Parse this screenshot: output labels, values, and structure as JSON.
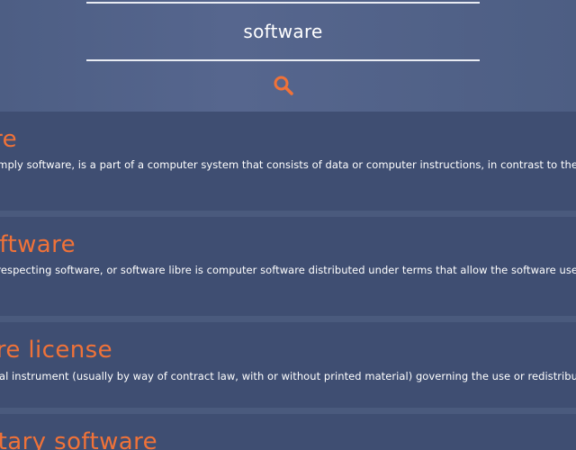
{
  "search": {
    "query": "software",
    "button_icon": "search-icon",
    "accent": "#f07238"
  },
  "results": [
    {
      "title": "Software",
      "snippet": "Computer software, or simply software, is a part of a computer system that consists of data or computer instructions, in contrast to the"
    },
    {
      "title": "Free software",
      "snippet": "Free software, freedom-respecting software, or software libre is computer software distributed under terms that allow the software use"
    },
    {
      "title": "Software license",
      "snippet": "A software license is a legal instrument (usually by way of contract law, with or without printed material) governing the use or redistribu"
    },
    {
      "title": "Proprietary software",
      "snippet": ""
    }
  ]
}
